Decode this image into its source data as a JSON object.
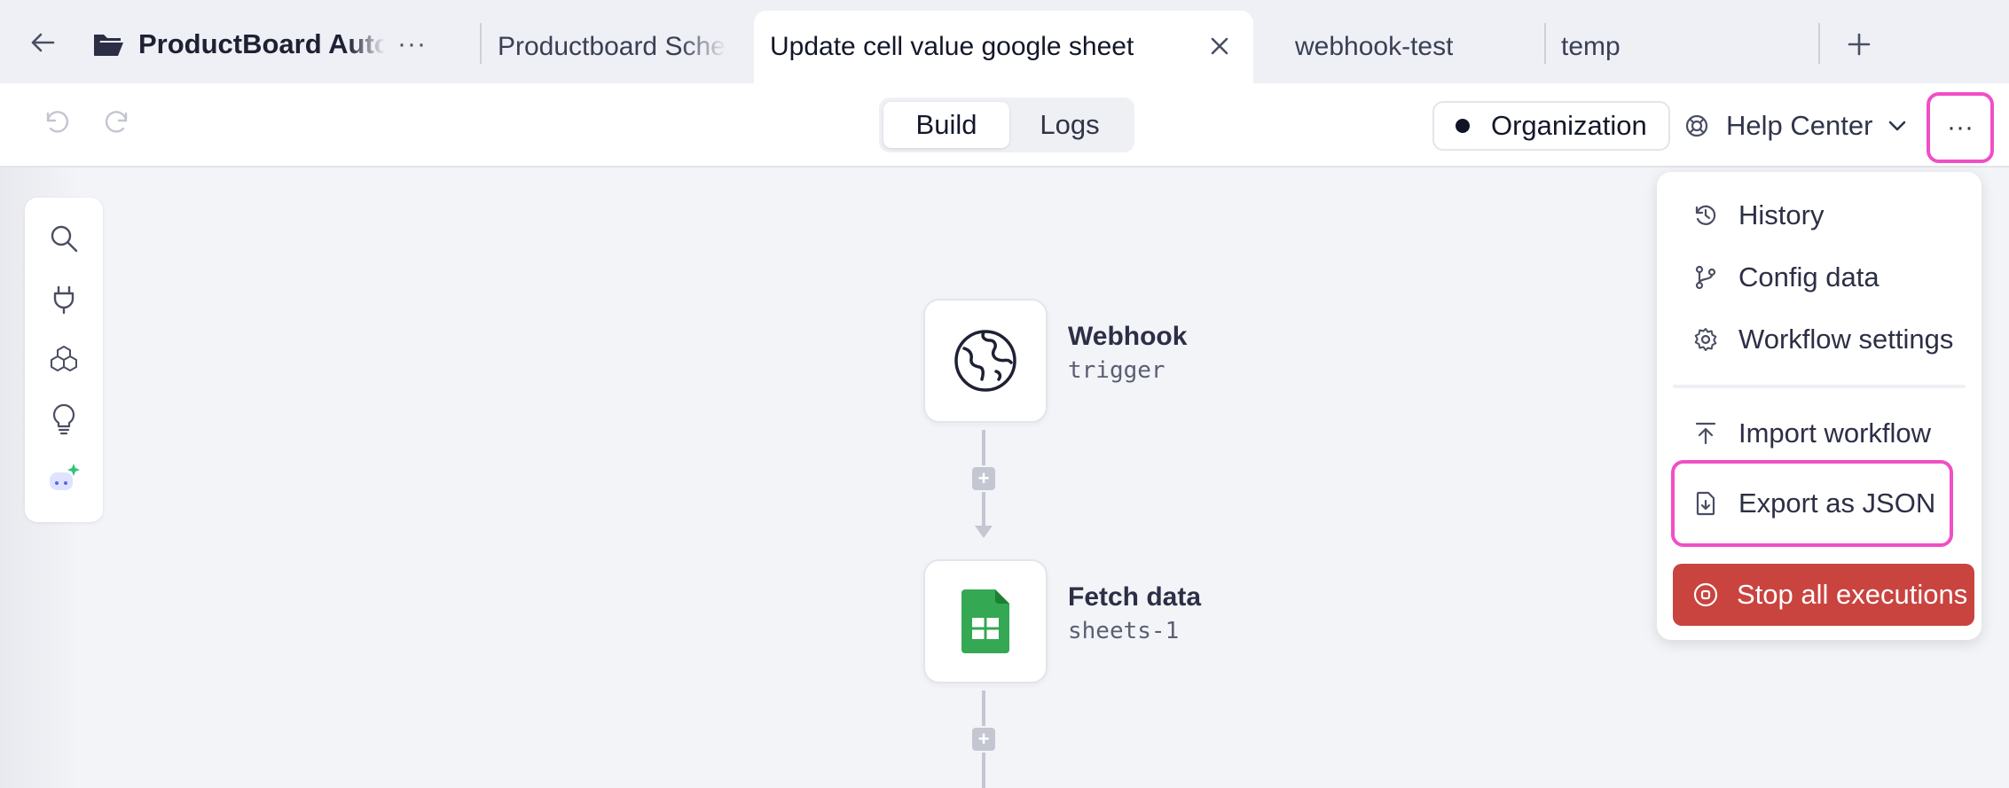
{
  "tabs": {
    "folder_label": "ProductBoard Automations",
    "folder_more": "···",
    "items": [
      {
        "label": "Productboard Schedule"
      },
      {
        "label": "Update cell value google sheet"
      },
      {
        "label": "webhook-test"
      },
      {
        "label": "temp"
      }
    ],
    "add_label": "+"
  },
  "toolbar": {
    "build_label": "Build",
    "logs_label": "Logs",
    "org_label": "Organization",
    "help_label": "Help Center",
    "more_label": "···"
  },
  "workflow": {
    "nodes": [
      {
        "title": "Webhook",
        "subtitle": "trigger",
        "icon": "globe-icon"
      },
      {
        "title": "Fetch data",
        "subtitle": "sheets-1",
        "icon": "google-sheets-icon"
      }
    ]
  },
  "menu": {
    "history": "History",
    "config_data": "Config data",
    "workflow_settings": "Workflow settings",
    "import_workflow": "Import workflow",
    "export_json": "Export as JSON",
    "stop_all": "Stop all executions"
  },
  "colors": {
    "highlight": "#f04fc6",
    "danger": "#c9433f",
    "sheets_green": "#34a853"
  }
}
